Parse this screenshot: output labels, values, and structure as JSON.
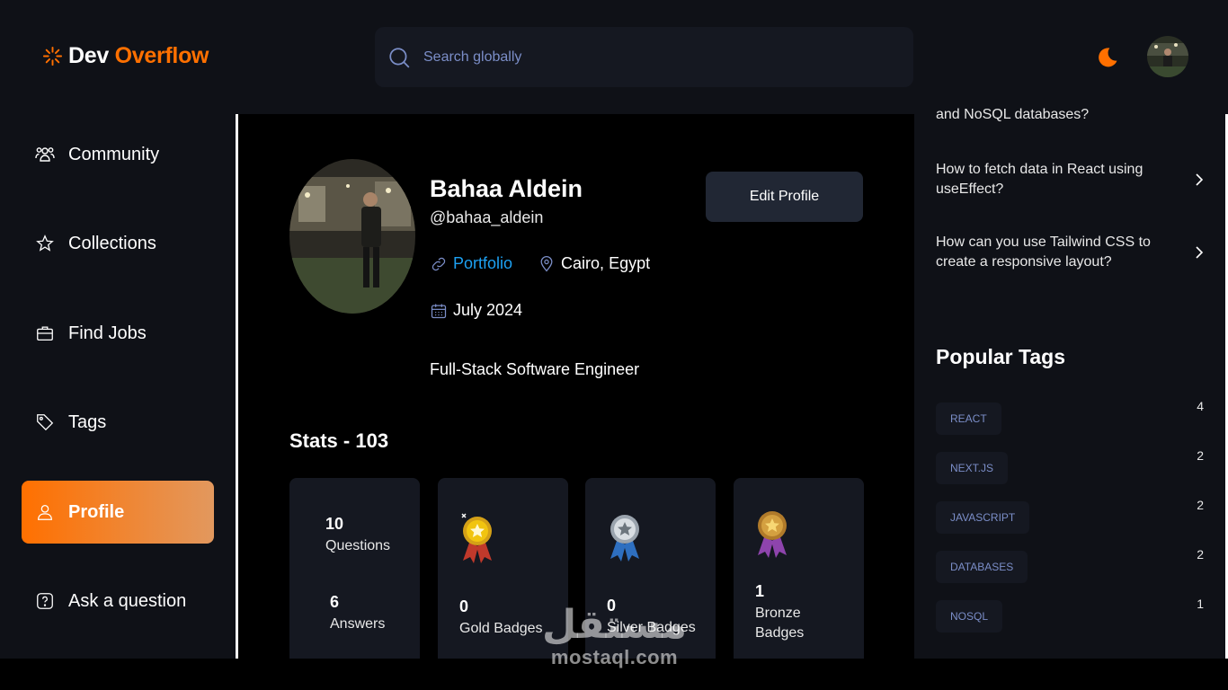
{
  "header": {
    "logo_part1": "Dev",
    "logo_part2": "Overflow",
    "search_placeholder": "Search globally"
  },
  "sidebar": {
    "items": [
      {
        "label": "Community",
        "icon": "users-icon"
      },
      {
        "label": "Collections",
        "icon": "star-icon"
      },
      {
        "label": "Find Jobs",
        "icon": "briefcase-icon"
      },
      {
        "label": "Tags",
        "icon": "tag-icon"
      },
      {
        "label": "Profile",
        "icon": "user-icon",
        "active": true
      },
      {
        "label": "Ask a question",
        "icon": "question-icon"
      }
    ]
  },
  "profile": {
    "name": "Bahaa Aldein",
    "username": "@bahaa_aldein",
    "portfolio_label": "Portfolio",
    "location": "Cairo, Egypt",
    "joined": "July 2024",
    "bio": "Full-Stack Software Engineer",
    "edit_label": "Edit Profile"
  },
  "stats": {
    "title": "Stats - 103",
    "questions_count": "10",
    "questions_label": "Questions",
    "answers_count": "6",
    "answers_label": "Answers",
    "gold_count": "0",
    "gold_label": "Gold Badges",
    "silver_count": "0",
    "silver_label": "Silver Badges",
    "bronze_count": "1",
    "bronze_label_1": "Bronze",
    "bronze_label_2": "Badges"
  },
  "right_sidebar": {
    "questions": [
      {
        "text": "and NoSQL databases?"
      },
      {
        "text": "How to fetch data in React using useEffect?"
      },
      {
        "text": "How can you use Tailwind CSS to create a responsive layout?"
      }
    ],
    "popular_tags_title": "Popular Tags",
    "tags": [
      {
        "name": "REACT",
        "count": "4"
      },
      {
        "name": "NEXT.JS",
        "count": "2"
      },
      {
        "name": "JAVASCRIPT",
        "count": "2"
      },
      {
        "name": "DATABASES",
        "count": "2"
      },
      {
        "name": "NOSQL",
        "count": "1"
      }
    ]
  },
  "watermark": {
    "arabic": "مستقل",
    "latin": "mostaql.com"
  },
  "colors": {
    "accent": "#ff7000",
    "link": "#1da1f2",
    "tag_text": "#7b8ec8",
    "card_bg": "#151821"
  }
}
